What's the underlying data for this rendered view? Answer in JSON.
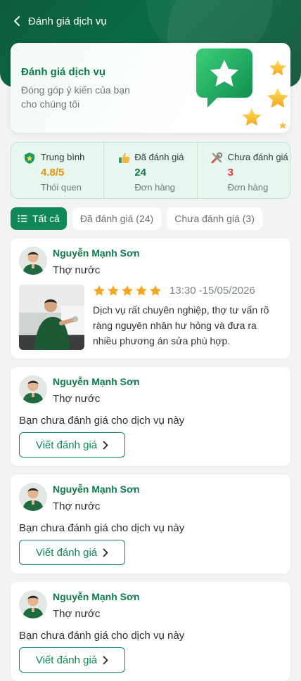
{
  "header": {
    "title": "Đánh giá dịch vụ"
  },
  "hero": {
    "title": "Đánh giá dịch vụ",
    "subtitle": "Đóng góp ý kiến của bạn cho chúng tôi"
  },
  "stats": [
    {
      "label": "Trung bình",
      "value": "4.8/5",
      "sub": "Thói quen",
      "color": "#e8930a",
      "icon": "shield-star-icon"
    },
    {
      "label": "Đã đánh giá",
      "value": "24",
      "sub": "Đơn hàng",
      "color": "#0c7a4c",
      "icon": "thumbs-up-icon"
    },
    {
      "label": "Chưa đánh giá",
      "value": "3",
      "sub": "Đơn hàng",
      "color": "#e53935",
      "icon": "tools-icon"
    }
  ],
  "tabs": [
    {
      "label": "Tất cả",
      "active": true
    },
    {
      "label": "Đã đánh giá (24)",
      "active": false
    },
    {
      "label": "Chưa đánh giá (3)",
      "active": false
    }
  ],
  "reviews": [
    {
      "name": "Nguyễn Mạnh Sơn",
      "role": "Thợ nước",
      "rating": 5,
      "time": "13:30 -15/05/2026",
      "text": "Dịch vụ rất chuyên nghiệp, thợ tư vấn rõ ràng nguyên nhân hư hỏng và đưa ra nhiều phương án sửa phù hợp."
    },
    {
      "name": "Nguyễn Mạnh Sơn",
      "role": "Thợ nước",
      "pending_text": "Bạn chưa đánh giá cho dịch vụ này",
      "button": "Viết đánh giá"
    },
    {
      "name": "Nguyễn Mạnh Sơn",
      "role": "Thợ nước",
      "pending_text": "Bạn chưa đánh giá cho dịch vụ này",
      "button": "Viết đánh giá"
    },
    {
      "name": "Nguyễn Mạnh Sơn",
      "role": "Thợ nước",
      "pending_text": "Bạn chưa đánh giá cho dịch vụ này",
      "button": "Viết đánh giá"
    }
  ],
  "colors": {
    "brand": "#0f8a57",
    "brand_dark": "#0b5336",
    "star": "#f5a623"
  }
}
